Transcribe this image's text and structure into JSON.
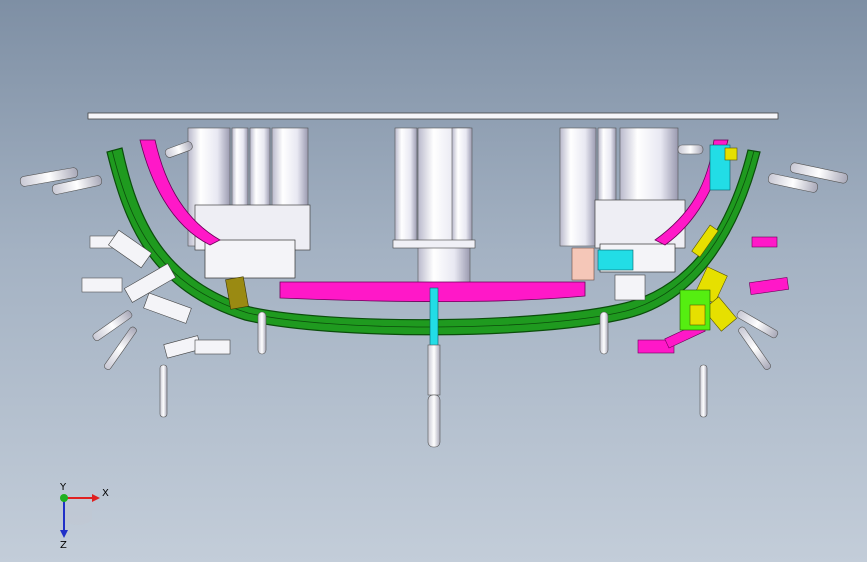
{
  "app": {
    "title": ""
  },
  "colors": {
    "background_top": "#7e8fa4",
    "background_bottom": "#c3cdd9",
    "rail_green": "#1f9a1f",
    "rail_green_dark": "#0b4d0b",
    "magenta": "#ff18c8",
    "cyan": "#22dde6",
    "yellow": "#e6e000",
    "lime": "#55ee11",
    "olive": "#9a8a12",
    "white_part": "#f4f4f8",
    "cylinder": "#e9e9f5",
    "peach": "#f5c7b8"
  },
  "triad": {
    "x_label": "X",
    "y_label": "Y",
    "z_label": "Z",
    "x_color": "#e02020",
    "y_color": "#20b020",
    "z_color": "#2030c8"
  }
}
